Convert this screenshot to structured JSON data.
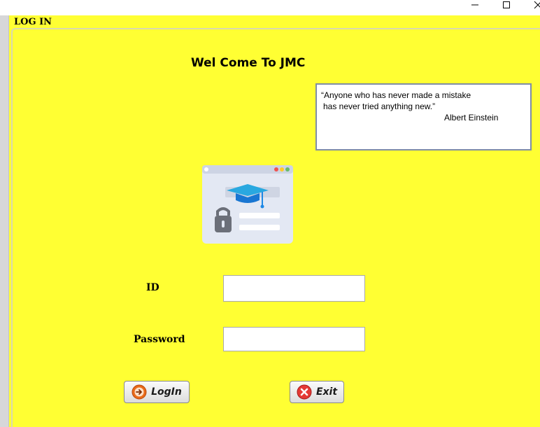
{
  "window": {
    "controls": {
      "minimize": "—",
      "maximize": "☐",
      "close": "✕"
    }
  },
  "panel": {
    "title": "LOG IN",
    "background_color": "#ffff33"
  },
  "welcome_text": "Wel Come To JMC",
  "quote": {
    "line1": "“Anyone who has never made a mistake",
    "line2": "has never tried anything new.”",
    "author": "Albert Einstein"
  },
  "illustration": {
    "icon": "graduation-cap-lock-icon"
  },
  "form": {
    "id_label": "ID",
    "id_value": "",
    "password_label": "Password",
    "password_value": ""
  },
  "buttons": {
    "login_label": "LogIn",
    "login_icon": "arrow-right-circle-icon",
    "exit_label": "Exit",
    "exit_icon": "close-circle-icon"
  }
}
